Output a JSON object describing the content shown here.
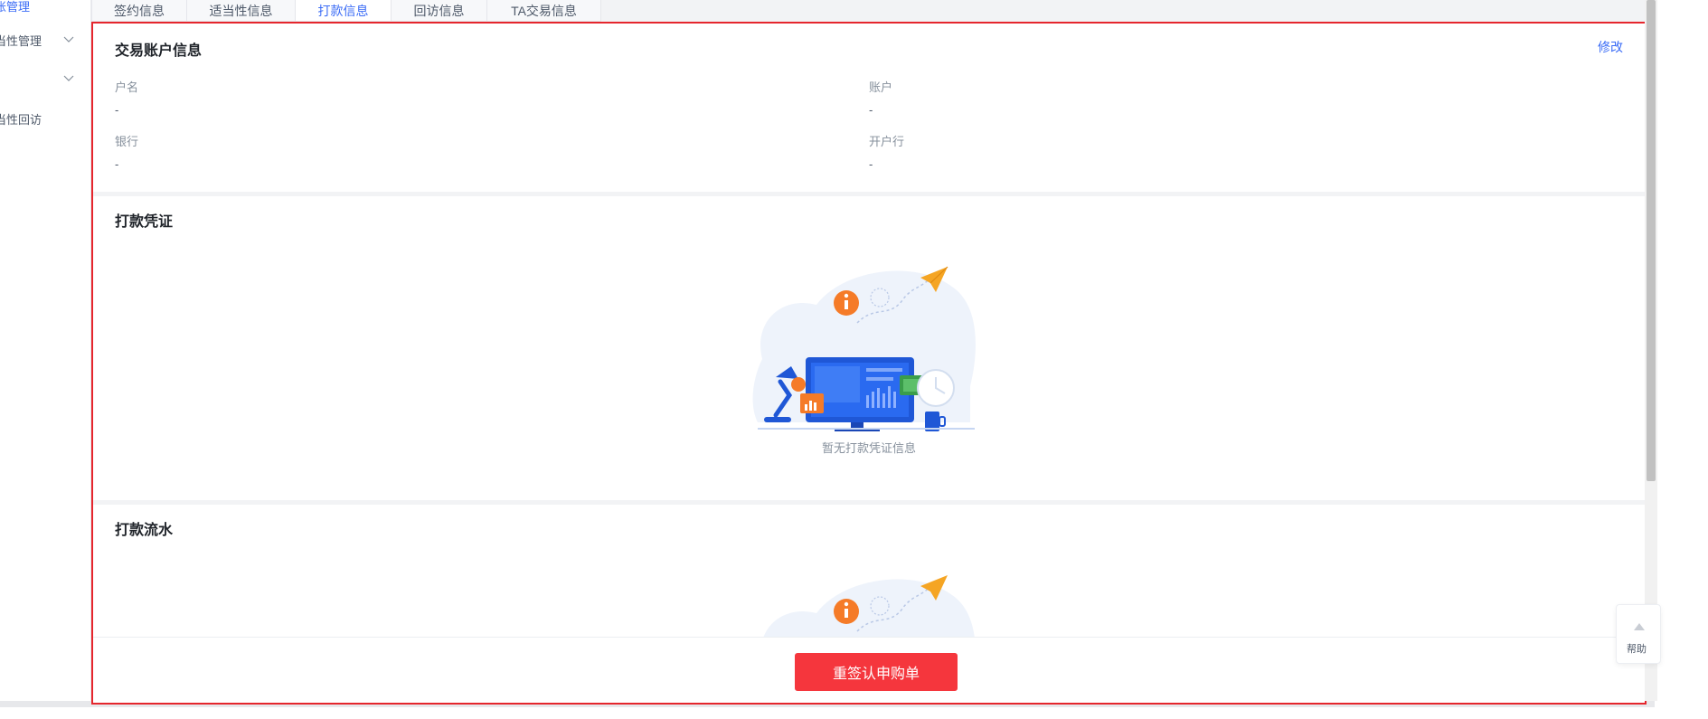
{
  "sidebar": {
    "items": [
      {
        "label": "账管理",
        "has_chevron": false,
        "active": true
      },
      {
        "label": "当性管理",
        "has_chevron": true,
        "active": false
      },
      {
        "label": "",
        "has_chevron": true,
        "active": false
      },
      {
        "label": "当性回访",
        "has_chevron": false,
        "active": false
      }
    ]
  },
  "tabs": [
    {
      "label": "签约信息",
      "active": false
    },
    {
      "label": "适当性信息",
      "active": false
    },
    {
      "label": "打款信息",
      "active": true
    },
    {
      "label": "回访信息",
      "active": false
    },
    {
      "label": "TA交易信息",
      "active": false
    }
  ],
  "account_section": {
    "title": "交易账户信息",
    "edit_label": "修改",
    "fields": {
      "name_label": "户名",
      "name_value": "-",
      "account_label": "账户",
      "account_value": "-",
      "bank_label": "银行",
      "bank_value": "-",
      "branch_label": "开户行",
      "branch_value": "-"
    }
  },
  "voucher_section": {
    "title": "打款凭证",
    "empty_text": "暂无打款凭证信息"
  },
  "flow_section": {
    "title": "打款流水"
  },
  "footer": {
    "primary_button": "重签认申购单"
  },
  "help": {
    "label": "帮助"
  },
  "colors": {
    "accent": "#3b6cf6",
    "danger": "#f5363d",
    "frame": "#e5262d"
  }
}
